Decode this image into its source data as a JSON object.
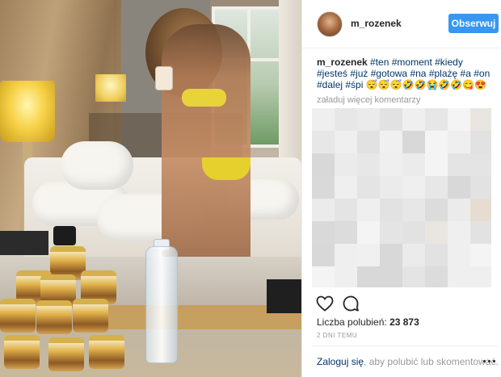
{
  "post": {
    "username": "m_rozenek",
    "follow_label": "Obserwuj",
    "caption": {
      "username": "m_rozenek",
      "tags": [
        "#ten",
        "#moment",
        "#kiedy",
        "#jesteś",
        "#już",
        "#gotowa",
        "#na",
        "#plażę",
        "#a",
        "#on",
        "#dalej",
        "#śpi"
      ],
      "emojis": "😴😴😴🤣🤣😭🤣🤣😋😍"
    },
    "load_more_comments": "załaduj więcej komentarzy",
    "likes_label": "Liczba polubień:",
    "likes_count": "23 873",
    "date": "2 DNI TEMU",
    "login_link": "Zaloguj się",
    "login_rest": ", aby polubić lub skomentować."
  },
  "icons": {
    "like": "heart-icon",
    "comment": "comment-icon",
    "more": "more-options-icon"
  },
  "colors": {
    "follow_button": "#3897f0",
    "tag_link": "#003569",
    "muted_text": "#999999",
    "text": "#262626"
  }
}
